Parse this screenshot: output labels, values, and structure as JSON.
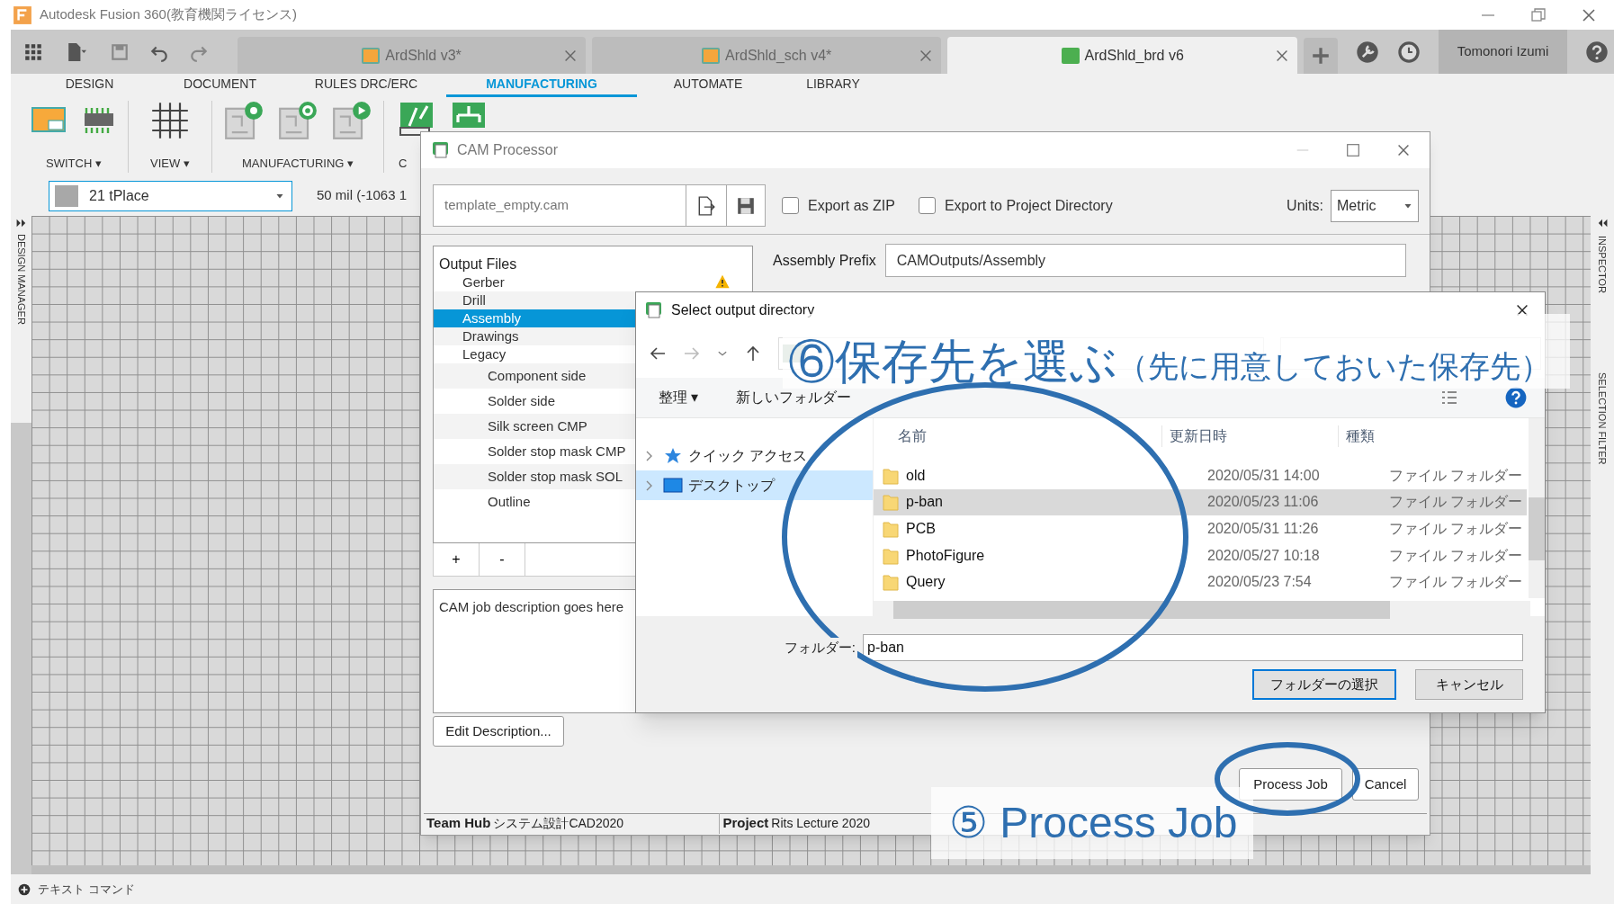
{
  "window": {
    "title": "Autodesk Fusion 360(教育機関ライセンス)"
  },
  "doc_tabs": [
    {
      "label": "ArdShld v3*",
      "selected": false
    },
    {
      "label": "ArdShld_sch v4*",
      "selected": false
    },
    {
      "label": "ArdShld_brd v6",
      "selected": true
    }
  ],
  "user": "Tomonori Izumi",
  "ribbon_tabs": [
    {
      "label": "DESIGN",
      "selected": false
    },
    {
      "label": "DOCUMENT",
      "selected": false
    },
    {
      "label": "RULES DRC/ERC",
      "selected": false
    },
    {
      "label": "MANUFACTURING",
      "selected": true
    },
    {
      "label": "AUTOMATE",
      "selected": false
    },
    {
      "label": "LIBRARY",
      "selected": false
    }
  ],
  "toolbar_groups": [
    {
      "label": "SWITCH ▾"
    },
    {
      "label": "VIEW ▾"
    },
    {
      "label": "MANUFACTURING ▾"
    },
    {
      "label": "C"
    }
  ],
  "layer_select": {
    "value": "21 tPlace"
  },
  "coordinates": "50 mil (-1063 1",
  "side_panels": {
    "left": "DESIGN MANAGER",
    "right": [
      "INSPECTOR",
      "SELECTION FILTER"
    ]
  },
  "command_line": {
    "placeholder": "テキスト コマンド"
  },
  "cam_processor": {
    "title": "CAM Processor",
    "template": "template_empty.cam",
    "options": [
      {
        "label": "Export as ZIP",
        "checked": false
      },
      {
        "label": "Export to Project Directory",
        "checked": false
      }
    ],
    "units_label": "Units:",
    "units": "Metric",
    "output_files": {
      "title": "Output Files",
      "items": [
        {
          "label": "Gerber",
          "selected": false,
          "warning": true
        },
        {
          "label": "Drill",
          "selected": false
        },
        {
          "label": "Assembly",
          "selected": true
        },
        {
          "label": "Drawings",
          "selected": false
        },
        {
          "label": "Legacy",
          "selected": false,
          "children": [
            {
              "label": "Component side",
              "selected": false
            },
            {
              "label": "Solder side",
              "selected": false
            },
            {
              "label": "Silk screen CMP",
              "selected": false
            },
            {
              "label": "Solder stop mask CMP",
              "selected": false
            },
            {
              "label": "Solder stop mask SOL",
              "selected": false
            },
            {
              "label": "Outline",
              "selected": false
            }
          ]
        }
      ]
    },
    "add_button": "+",
    "remove_button": "-",
    "assembly_prefix_label": "Assembly Prefix",
    "assembly_prefix": "CAMOutputs/Assembly",
    "description": "CAM job description goes here",
    "edit_description": "Edit Description...",
    "process_job": "Process Job",
    "cancel": "Cancel",
    "status": [
      {
        "label": "Team Hub",
        "value": "システム設計CAD2020"
      },
      {
        "label": "Project",
        "value": "Rits Lecture 2020"
      }
    ]
  },
  "folder_dialog": {
    "title": "Select output directory",
    "organize": "整理 ▾",
    "new_folder": "新しいフォルダー",
    "nav": [
      {
        "label": "クイック アクセス",
        "selected": false
      },
      {
        "label": "デスクトップ",
        "selected": true
      }
    ],
    "columns": [
      "名前",
      "更新日時",
      "種類"
    ],
    "rows": [
      {
        "name": "old",
        "date": "2020/05/31 14:00",
        "type": "ファイル フォルダー",
        "selected": false
      },
      {
        "name": "p-ban",
        "date": "2020/05/23 11:06",
        "type": "ファイル フォルダー",
        "selected": true
      },
      {
        "name": "PCB",
        "date": "2020/05/31 11:26",
        "type": "ファイル フォルダー",
        "selected": false
      },
      {
        "name": "PhotoFigure",
        "date": "2020/05/27 10:18",
        "type": "ファイル フォルダー",
        "selected": false
      },
      {
        "name": "Query",
        "date": "2020/05/23 7:54",
        "type": "ファイル フォルダー",
        "selected": false
      }
    ],
    "folder_label": "フォルダー:",
    "folder_value": "p-ban",
    "buttons": [
      "フォルダーの選択",
      "キャンセル"
    ]
  },
  "annotations": [
    {
      "number": "⑥",
      "text": "保存先を選ぶ",
      "note": "（先に用意しておいた保存先）"
    },
    {
      "number": "⑤",
      "text": "Process Job"
    }
  ]
}
